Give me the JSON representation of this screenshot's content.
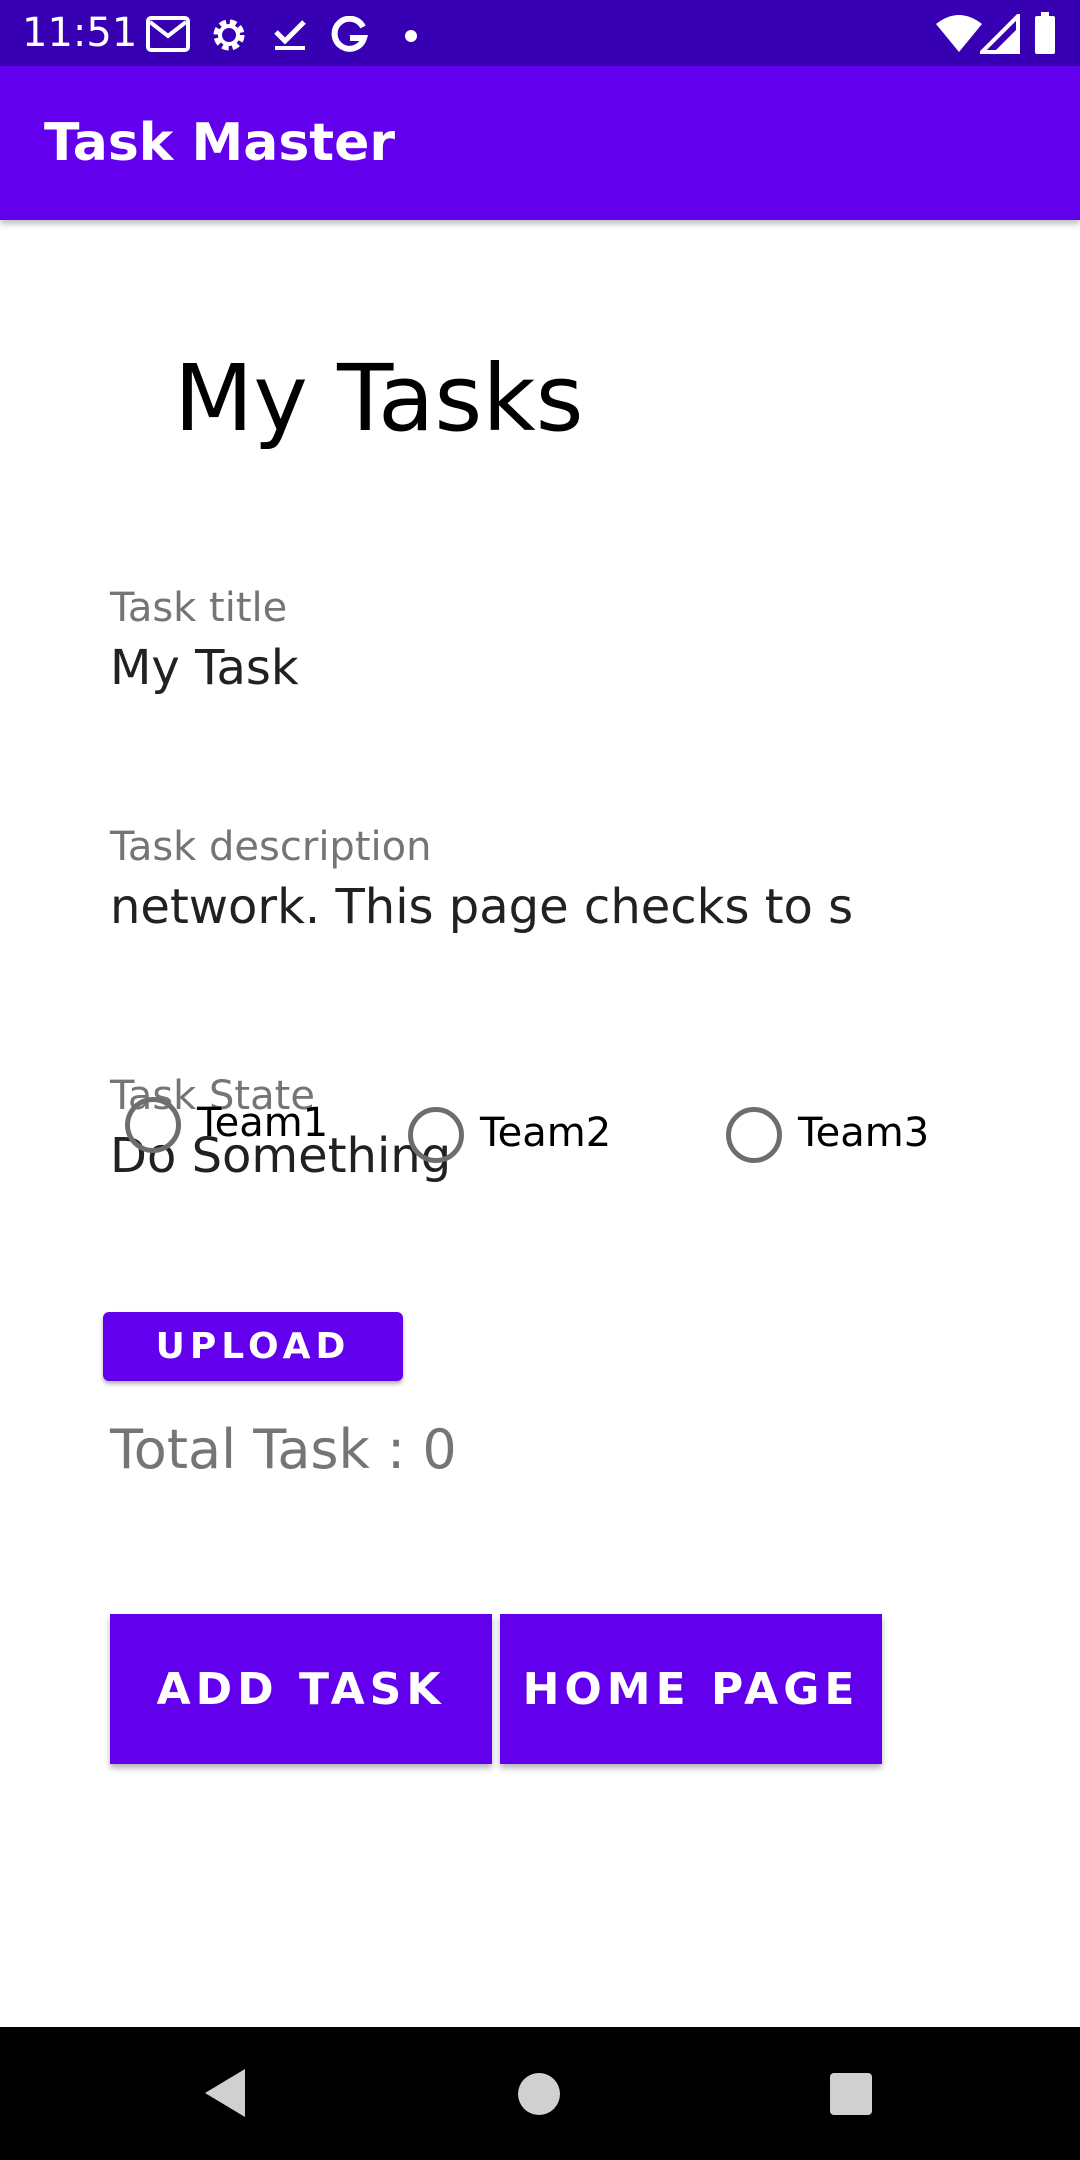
{
  "status_bar": {
    "time": "11:51",
    "left_icons": [
      "gmail-icon",
      "settings-gear-icon",
      "task-check-icon",
      "google-g-icon",
      "notification-dot-icon"
    ],
    "right_icons": [
      "wifi-icon",
      "cellular-signal-icon",
      "battery-icon"
    ]
  },
  "app_bar": {
    "title": "Task Master"
  },
  "main": {
    "heading": "My Tasks",
    "task_title": {
      "label": "Task title",
      "value": "My Task"
    },
    "task_description": {
      "label": "Task description",
      "value": "network. This page checks to s"
    },
    "task_state": {
      "label": "Task State",
      "value": "Do Something"
    },
    "teams": [
      {
        "label": "Team1",
        "selected": false
      },
      {
        "label": "Team2",
        "selected": false
      },
      {
        "label": "Team3",
        "selected": false
      }
    ],
    "upload_label": "UPLOAD",
    "total_task": "Total Task : 0",
    "add_task_label": "ADD TASK",
    "home_page_label": "HOME PAGE"
  },
  "colors": {
    "status_bar": "#3700b3",
    "primary": "#6200ee",
    "hint_text": "#757575",
    "nav_bar": "#000000"
  },
  "nav_bar": {
    "icons": [
      "back-icon",
      "home-icon",
      "recents-icon"
    ]
  }
}
